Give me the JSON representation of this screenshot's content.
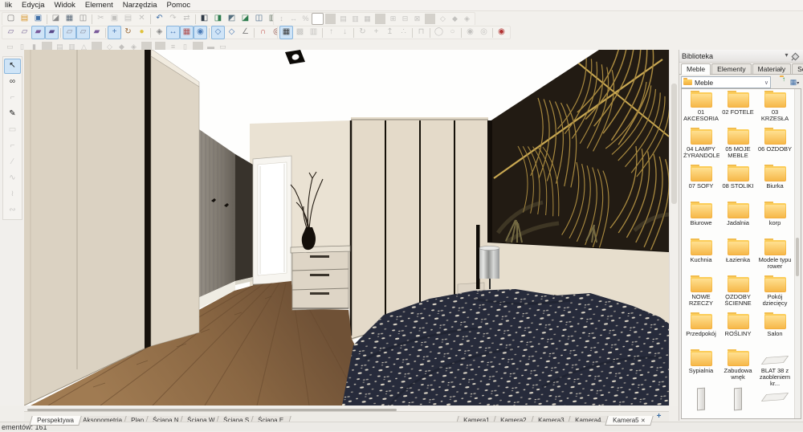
{
  "window": {
    "status_text": "ementów: 161"
  },
  "menu": {
    "items": [
      {
        "label": "lik"
      },
      {
        "label": "Edycja"
      },
      {
        "label": "Widok"
      },
      {
        "label": "Element"
      },
      {
        "label": "Narzędzia"
      },
      {
        "label": "Pomoc"
      }
    ]
  },
  "toolbar": {
    "row1a": [
      {
        "name": "new-file-icon",
        "glyph": "▢",
        "color": "#6b6b6b",
        "state": "normal"
      },
      {
        "name": "open-file-icon",
        "glyph": "▤",
        "color": "#d8982f",
        "state": "normal"
      },
      {
        "name": "save-icon",
        "glyph": "▣",
        "color": "#3f6fa8",
        "state": "normal"
      },
      {
        "state": "sep",
        "name": "separator"
      },
      {
        "name": "import-icon",
        "glyph": "◪",
        "color": "#8a8a8a",
        "state": "normal"
      },
      {
        "name": "print-icon",
        "glyph": "▦",
        "color": "#5a6a7a",
        "state": "normal"
      },
      {
        "name": "print-preview-icon",
        "glyph": "◫",
        "color": "#8a8a8a",
        "state": "normal"
      },
      {
        "state": "sep",
        "name": "separator"
      },
      {
        "name": "cut-icon",
        "glyph": "✂",
        "state": "disabled"
      },
      {
        "name": "copy-icon",
        "glyph": "▣",
        "state": "disabled"
      },
      {
        "name": "paste-icon",
        "glyph": "▤",
        "state": "disabled"
      },
      {
        "name": "delete-icon",
        "glyph": "✕",
        "state": "disabled"
      },
      {
        "state": "sep",
        "name": "separator"
      },
      {
        "name": "undo-icon",
        "glyph": "↶",
        "color": "#3f6fa8",
        "state": "normal"
      },
      {
        "name": "redo-icon",
        "glyph": "↷",
        "state": "disabled"
      },
      {
        "name": "sync-icon",
        "glyph": "⇄",
        "state": "disabled"
      },
      {
        "state": "sep",
        "name": "separator"
      },
      {
        "name": "project-panel-icon",
        "glyph": "◧",
        "color": "#2f3a46",
        "state": "normal"
      },
      {
        "name": "elements-panel-icon",
        "glyph": "◨",
        "color": "#2e7d4f",
        "state": "normal"
      },
      {
        "name": "zoom-window-icon",
        "glyph": "◩",
        "color": "#56707f",
        "state": "normal"
      },
      {
        "name": "layers-panel-icon",
        "glyph": "◪",
        "color": "#2e7d4f",
        "state": "normal"
      },
      {
        "name": "views-panel-icon",
        "glyph": "◫",
        "color": "#4a6a8a",
        "state": "normal"
      },
      {
        "name": "library-panel-icon",
        "glyph": "▥",
        "color": "#6a7a6a",
        "state": "normal"
      },
      {
        "name": "render-panel-icon",
        "glyph": "▨",
        "color": "#7a8a3a",
        "state": "normal"
      },
      {
        "name": "sum-icon",
        "glyph": "Σ",
        "color": "#222222",
        "state": "normal"
      }
    ],
    "row1b": [
      {
        "name": "move-vertical-icon",
        "glyph": "↕",
        "state": "disabled"
      },
      {
        "name": "move-horizontal-icon",
        "glyph": "↔",
        "state": "disabled"
      },
      {
        "name": "scale-percent-icon",
        "glyph": "%",
        "state": "disabled"
      },
      {
        "state": "combo",
        "name": "layer-combo"
      },
      {
        "state": "sep",
        "name": "separator"
      },
      {
        "name": "group-icon",
        "glyph": "▤",
        "state": "disabled"
      },
      {
        "name": "ungroup-icon",
        "glyph": "▥",
        "state": "disabled"
      },
      {
        "name": "lock-icon",
        "glyph": "▦",
        "state": "disabled"
      },
      {
        "state": "sep",
        "name": "separator"
      },
      {
        "name": "align-left-icon",
        "glyph": "⊞",
        "state": "disabled"
      },
      {
        "name": "align-center-icon",
        "glyph": "⊟",
        "state": "disabled"
      },
      {
        "name": "align-right-icon",
        "glyph": "⊠",
        "state": "disabled"
      },
      {
        "state": "sep",
        "name": "separator"
      },
      {
        "name": "rotate-left-icon",
        "glyph": "◇",
        "state": "disabled"
      },
      {
        "name": "rotate-right-icon",
        "glyph": "◆",
        "state": "disabled"
      },
      {
        "name": "mirror-icon",
        "glyph": "◈",
        "state": "disabled"
      }
    ],
    "row2a": [
      {
        "name": "view-wireframe-icon",
        "glyph": "▱",
        "color": "#7a6a9a",
        "state": "normal"
      },
      {
        "name": "view-hiddenline-icon",
        "glyph": "▱",
        "color": "#7a6a9a",
        "state": "normal"
      },
      {
        "name": "view-shaded-icon",
        "glyph": "▰",
        "color": "#7a5a9a",
        "state": "active"
      },
      {
        "name": "view-rendered-icon",
        "glyph": "▰",
        "color": "#5a4a8a",
        "state": "active"
      },
      {
        "state": "sep",
        "name": "separator"
      },
      {
        "name": "view-white-model-icon",
        "glyph": "▱",
        "color": "#8a8a9a",
        "state": "active"
      },
      {
        "name": "view-outline-icon",
        "glyph": "▱",
        "color": "#8a8a9a",
        "state": "active"
      },
      {
        "name": "view-solid-icon",
        "glyph": "▰",
        "color": "#7a5a9a",
        "state": "normal"
      },
      {
        "state": "sep",
        "name": "separator"
      },
      {
        "name": "move-mode-icon",
        "glyph": "+",
        "color": "#4a7ab5",
        "state": "active"
      },
      {
        "name": "orbit-mode-icon",
        "glyph": "↻",
        "color": "#9a6a3a",
        "state": "normal"
      },
      {
        "name": "light-icon",
        "glyph": "●",
        "color": "#e0c23a",
        "state": "normal"
      },
      {
        "state": "sep",
        "name": "separator"
      },
      {
        "name": "texture-icon",
        "glyph": "◈",
        "color": "#888888",
        "state": "normal"
      },
      {
        "name": "dimension-icon",
        "glyph": "↔",
        "color": "#4a7ab5",
        "state": "active"
      },
      {
        "name": "grid-table-icon",
        "glyph": "▦",
        "color": "#b05050",
        "state": "active"
      },
      {
        "name": "visibility-icon",
        "glyph": "◉",
        "color": "#4a7ab5",
        "state": "active"
      },
      {
        "state": "sep",
        "name": "separator"
      },
      {
        "name": "snap-point-icon",
        "glyph": "◇",
        "color": "#4a7ab5",
        "state": "active"
      },
      {
        "name": "snap-edge-icon",
        "glyph": "◇",
        "color": "#4a7ab5",
        "state": "normal"
      },
      {
        "name": "snap-angle-icon",
        "glyph": "∠",
        "color": "#888888",
        "state": "normal"
      },
      {
        "state": "sep",
        "name": "separator"
      },
      {
        "name": "magnet-icon",
        "glyph": "∩",
        "color": "#c2504a",
        "state": "normal"
      },
      {
        "name": "magnet-strong-icon",
        "glyph": "◎",
        "color": "#8a4a42",
        "state": "normal"
      },
      {
        "state": "sep",
        "name": "separator"
      },
      {
        "name": "search-icon",
        "glyph": "○",
        "state": "disabled"
      },
      {
        "state": "search",
        "name": "toolbar-search-input"
      },
      {
        "name": "search-go-icon",
        "glyph": "○",
        "state": "disabled"
      }
    ],
    "row2b": [
      {
        "name": "snap-grid-icon",
        "glyph": "▦",
        "color": "#3a3a3a",
        "state": "active"
      },
      {
        "name": "grid-settings-icon",
        "glyph": "▩",
        "state": "disabled"
      },
      {
        "name": "grid-hide-icon",
        "glyph": "▥",
        "state": "disabled"
      },
      {
        "state": "sep",
        "name": "separator"
      },
      {
        "name": "move-up-icon",
        "glyph": "↑",
        "state": "disabled"
      },
      {
        "name": "move-down-icon",
        "glyph": "↓",
        "state": "disabled"
      },
      {
        "state": "sep",
        "name": "separator"
      },
      {
        "name": "rotate-object-icon",
        "glyph": "↻",
        "state": "disabled"
      },
      {
        "name": "translate-object-icon",
        "glyph": "+",
        "state": "disabled"
      },
      {
        "name": "lift-object-icon",
        "glyph": "↥",
        "state": "disabled"
      },
      {
        "name": "scatter-icon",
        "glyph": "∴",
        "state": "disabled"
      },
      {
        "state": "sep",
        "name": "separator"
      },
      {
        "name": "constraint-icon",
        "glyph": "⊓",
        "state": "disabled"
      },
      {
        "state": "sep",
        "name": "separator"
      },
      {
        "name": "ellipse-icon",
        "glyph": "◯",
        "state": "disabled"
      },
      {
        "name": "oval-icon",
        "glyph": "○",
        "state": "disabled"
      },
      {
        "state": "sep",
        "name": "separator"
      },
      {
        "name": "sphere-icon",
        "glyph": "◉",
        "state": "disabled"
      },
      {
        "name": "torus-icon",
        "glyph": "◎",
        "state": "disabled"
      },
      {
        "state": "sep",
        "name": "separator"
      },
      {
        "name": "target-icon",
        "glyph": "◉",
        "color": "#b03030",
        "state": "normal"
      }
    ],
    "row3": [
      {
        "name": "wall-tool-icon",
        "glyph": "▭",
        "state": "disabled"
      },
      {
        "name": "wall-thick-tool-icon",
        "glyph": "▯",
        "state": "disabled"
      },
      {
        "name": "wall-solid-tool-icon",
        "glyph": "▮",
        "state": "disabled"
      },
      {
        "state": "sep",
        "name": "separator"
      },
      {
        "name": "floor-tool-icon",
        "glyph": "▤",
        "state": "disabled"
      },
      {
        "name": "ceiling-tool-icon",
        "glyph": "▥",
        "state": "disabled"
      },
      {
        "name": "roof-tool-icon",
        "glyph": "△",
        "state": "disabled"
      },
      {
        "state": "sep",
        "name": "separator"
      },
      {
        "name": "door-tool-icon",
        "glyph": "◇",
        "state": "disabled"
      },
      {
        "name": "window-tool-icon",
        "glyph": "◆",
        "state": "disabled"
      },
      {
        "name": "opening-tool-icon",
        "glyph": "◈",
        "state": "disabled"
      },
      {
        "state": "sep",
        "name": "separator"
      },
      {
        "state": "sep",
        "name": "separator"
      },
      {
        "name": "stairs-tool-icon",
        "glyph": "≡",
        "state": "disabled"
      },
      {
        "name": "column-tool-icon",
        "glyph": "▯",
        "state": "disabled"
      },
      {
        "state": "sep",
        "name": "separator"
      },
      {
        "name": "beam-tool-icon",
        "glyph": "▬",
        "state": "disabled"
      },
      {
        "name": "slab-tool-icon",
        "glyph": "▭",
        "state": "disabled"
      }
    ],
    "left": [
      {
        "name": "select-tool-icon",
        "glyph": "↖",
        "color": "#111111",
        "state": "active"
      },
      {
        "name": "walk-tool-icon",
        "glyph": "∞",
        "color": "#333333",
        "state": "normal"
      },
      {
        "name": "measure-tool-icon",
        "glyph": "⌐",
        "state": "disabled"
      },
      {
        "name": "pipette-tool-icon",
        "glyph": "✎",
        "color": "#111111",
        "state": "normal"
      },
      {
        "name": "rect-tool-icon",
        "glyph": "▭",
        "state": "disabled"
      },
      {
        "name": "polyline-tool-icon",
        "glyph": "⌐",
        "state": "disabled"
      },
      {
        "name": "line-tool-icon",
        "glyph": "∕",
        "state": "disabled"
      },
      {
        "name": "arc-tool-icon",
        "glyph": "∿",
        "state": "disabled"
      },
      {
        "name": "spline-tool-icon",
        "glyph": "≀",
        "state": "disabled"
      },
      {
        "name": "freehand-tool-icon",
        "glyph": "∾",
        "state": "disabled"
      }
    ]
  },
  "viewport": {
    "view_tabs": [
      {
        "label": "Perspektywa",
        "state": "active"
      },
      {
        "label": "Aksonometria",
        "state": "normal"
      },
      {
        "label": "Plan",
        "state": "normal"
      },
      {
        "label": "Ściana N",
        "state": "normal"
      },
      {
        "label": "Ściana W",
        "state": "normal"
      },
      {
        "label": "Ściana S",
        "state": "normal"
      },
      {
        "label": "Ściana E",
        "state": "normal"
      }
    ],
    "camera_tabs": [
      {
        "label": "Kamera1",
        "state": "normal",
        "close": ""
      },
      {
        "label": "Kamera2",
        "state": "normal",
        "close": ""
      },
      {
        "label": "Kamera3",
        "state": "normal",
        "close": ""
      },
      {
        "label": "Kamera4",
        "state": "normal",
        "close": ""
      },
      {
        "label": "Kamera5",
        "state": "active",
        "close": "✕"
      }
    ],
    "add_camera_label": "+"
  },
  "library": {
    "title": "Biblioteka",
    "tabs": [
      {
        "label": "Meble",
        "state": "active"
      },
      {
        "label": "Elementy",
        "state": "normal"
      },
      {
        "label": "Materiały",
        "state": "normal"
      },
      {
        "label": "Schowek",
        "state": "normal"
      }
    ],
    "path_value": "Meble",
    "folders": [
      {
        "label": "01 AKCESORIA",
        "type": "folder",
        "icon": "folder-icon"
      },
      {
        "label": "02 FOTELE",
        "type": "folder",
        "icon": "folder-icon"
      },
      {
        "label": "03 KRZESŁA",
        "type": "folder",
        "icon": "folder-icon"
      },
      {
        "label": "04 LAMPY ŻYRANDOLE",
        "type": "folder",
        "icon": "folder-icon"
      },
      {
        "label": "05 MOJE MEBLE",
        "type": "folder",
        "icon": "folder-icon"
      },
      {
        "label": "06 OZDOBY",
        "type": "folder",
        "icon": "folder-icon"
      },
      {
        "label": "07 SOFY",
        "type": "folder",
        "icon": "folder-icon"
      },
      {
        "label": "08 STOLIKI",
        "type": "folder",
        "icon": "folder-icon"
      },
      {
        "label": "Biurka",
        "type": "folder",
        "icon": "folder-icon"
      },
      {
        "label": "Biurowe",
        "type": "folder",
        "icon": "folder-icon"
      },
      {
        "label": "Jadalnia",
        "type": "folder",
        "icon": "folder-icon"
      },
      {
        "label": "korp",
        "type": "folder",
        "icon": "folder-icon"
      },
      {
        "label": "Kuchnia",
        "type": "folder",
        "icon": "folder-icon"
      },
      {
        "label": "Łazienka",
        "type": "folder",
        "icon": "folder-icon"
      },
      {
        "label": "Modele typu rower",
        "type": "folder",
        "icon": "folder-icon"
      },
      {
        "label": "NOWE RZECZY",
        "type": "folder",
        "icon": "folder-icon"
      },
      {
        "label": "OZDOBY ŚCIENNE",
        "type": "folder",
        "icon": "folder-icon"
      },
      {
        "label": "Pokój dziecięcy",
        "type": "folder",
        "icon": "folder-icon"
      },
      {
        "label": "Przedpokój",
        "type": "folder",
        "icon": "folder-icon"
      },
      {
        "label": "ROŚLINY",
        "type": "folder",
        "icon": "folder-icon"
      },
      {
        "label": "Salon",
        "type": "folder",
        "icon": "folder-icon"
      },
      {
        "label": "Sypialnia",
        "type": "folder",
        "icon": "folder-icon"
      },
      {
        "label": "Zabudowa wnęk",
        "type": "folder",
        "icon": "folder-icon"
      },
      {
        "label": "BLAT 38 z zaobleniem kr...",
        "type": "board",
        "icon": "board-thumbnail"
      },
      {
        "label": "",
        "type": "panel",
        "icon": "panel-thumbnail"
      },
      {
        "label": "",
        "type": "panel",
        "icon": "panel-thumbnail"
      },
      {
        "label": "",
        "type": "board",
        "icon": "board-thumbnail"
      }
    ]
  },
  "colors": {
    "toolbar_active_bg": "#cfe4f7",
    "folder_yellow": "#f5b63e",
    "accent_blue": "#3f6fa8",
    "magnet_red": "#c2504a",
    "record_red": "#b03030",
    "wallpaper_gold": "#b29245",
    "wallpaper_dark": "#221b13",
    "bed_navy": "#272b3b",
    "floor_brown": "#8a6743",
    "wardrobe_cream": "#ddd4c5"
  }
}
